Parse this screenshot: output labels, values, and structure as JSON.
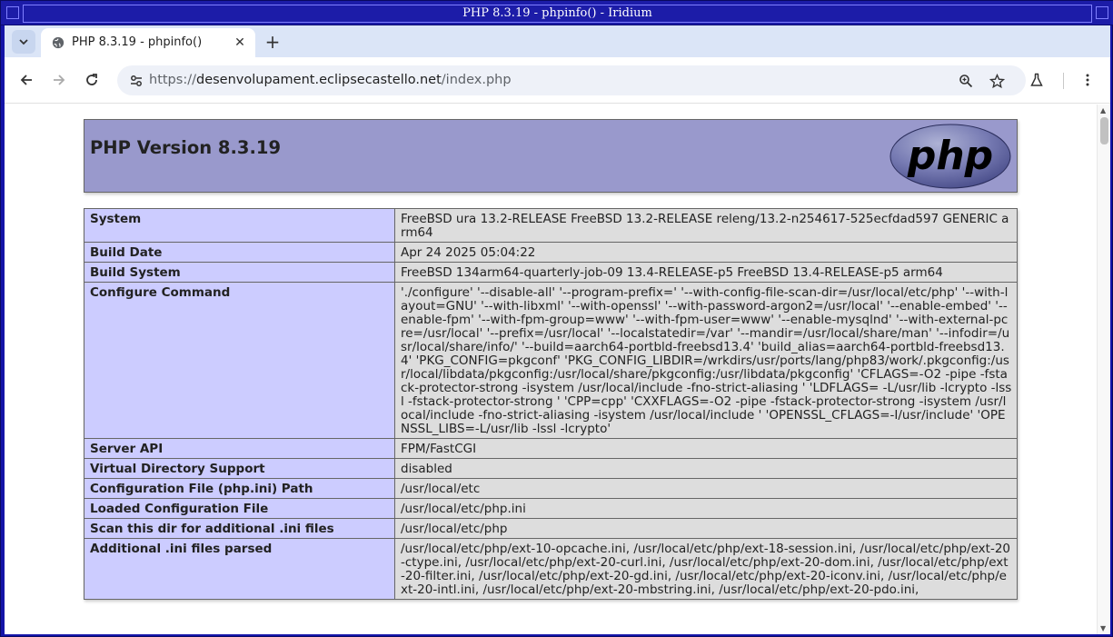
{
  "window": {
    "title": "PHP 8.3.19 - phpinfo() - Iridium"
  },
  "tabs": [
    {
      "title": "PHP 8.3.19 - phpinfo()",
      "icon": "globe-icon",
      "active": true
    }
  ],
  "toolbar": {
    "url_scheme": "https://",
    "url_host": "desenvolupament.eclipsecastello.net",
    "url_path": "/index.php"
  },
  "page": {
    "heading": "PHP Version 8.3.19",
    "logo_text": "php",
    "rows": [
      {
        "key": "System",
        "value": "FreeBSD ura 13.2-RELEASE FreeBSD 13.2-RELEASE releng/13.2-n254617-525ecfdad597 GENERIC arm64"
      },
      {
        "key": "Build Date",
        "value": "Apr 24 2025 05:04:22"
      },
      {
        "key": "Build System",
        "value": "FreeBSD 134arm64-quarterly-job-09 13.4-RELEASE-p5 FreeBSD 13.4-RELEASE-p5 arm64"
      },
      {
        "key": "Configure Command",
        "value": "'./configure' '--disable-all' '--program-prefix=' '--with-config-file-scan-dir=/usr/local/etc/php' '--with-layout=GNU' '--with-libxml' '--with-openssl' '--with-password-argon2=/usr/local' '--enable-embed' '--enable-fpm' '--with-fpm-group=www' '--with-fpm-user=www' '--enable-mysqlnd' '--with-external-pcre=/usr/local' '--prefix=/usr/local' '--localstatedir=/var' '--mandir=/usr/local/share/man' '--infodir=/usr/local/share/info/' '--build=aarch64-portbld-freebsd13.4' 'build_alias=aarch64-portbld-freebsd13.4' 'PKG_CONFIG=pkgconf' 'PKG_CONFIG_LIBDIR=/wrkdirs/usr/ports/lang/php83/work/.pkgconfig:/usr/local/libdata/pkgconfig:/usr/local/share/pkgconfig:/usr/libdata/pkgconfig' 'CFLAGS=-O2 -pipe -fstack-protector-strong -isystem /usr/local/include -fno-strict-aliasing ' 'LDFLAGS= -L/usr/lib -lcrypto -lssl -fstack-protector-strong ' 'CPP=cpp' 'CXXFLAGS=-O2 -pipe -fstack-protector-strong -isystem /usr/local/include -fno-strict-aliasing -isystem /usr/local/include ' 'OPENSSL_CFLAGS=-I/usr/include' 'OPENSSL_LIBS=-L/usr/lib -lssl -lcrypto'"
      },
      {
        "key": "Server API",
        "value": "FPM/FastCGI"
      },
      {
        "key": "Virtual Directory Support",
        "value": "disabled"
      },
      {
        "key": "Configuration File (php.ini) Path",
        "value": "/usr/local/etc"
      },
      {
        "key": "Loaded Configuration File",
        "value": "/usr/local/etc/php.ini"
      },
      {
        "key": "Scan this dir for additional .ini files",
        "value": "/usr/local/etc/php"
      },
      {
        "key": "Additional .ini files parsed",
        "value": "/usr/local/etc/php/ext-10-opcache.ini, /usr/local/etc/php/ext-18-session.ini, /usr/local/etc/php/ext-20-ctype.ini, /usr/local/etc/php/ext-20-curl.ini, /usr/local/etc/php/ext-20-dom.ini, /usr/local/etc/php/ext-20-filter.ini, /usr/local/etc/php/ext-20-gd.ini, /usr/local/etc/php/ext-20-iconv.ini, /usr/local/etc/php/ext-20-intl.ini, /usr/local/etc/php/ext-20-mbstring.ini, /usr/local/etc/php/ext-20-pdo.ini,"
      }
    ]
  }
}
